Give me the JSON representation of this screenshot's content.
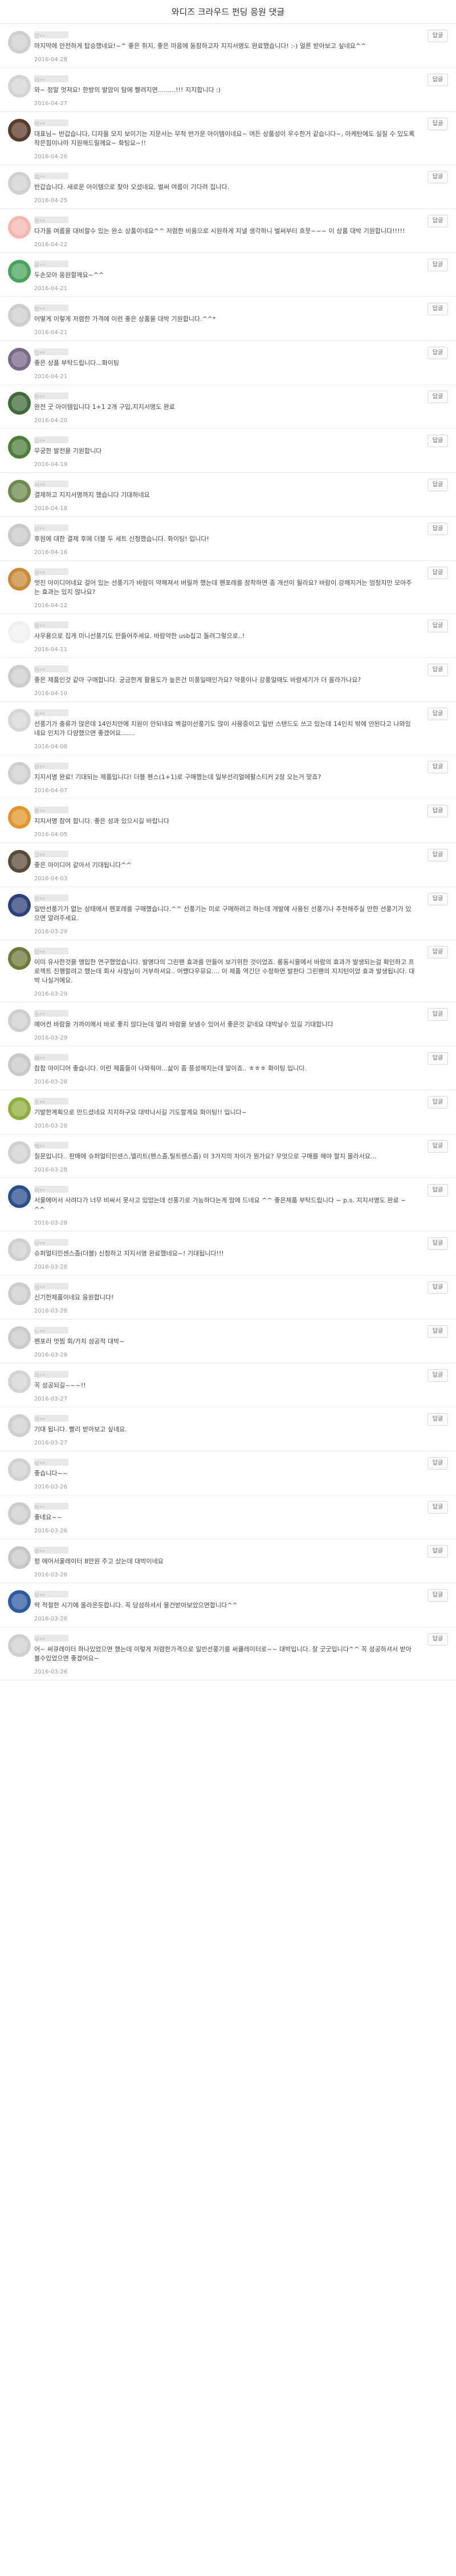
{
  "page": {
    "title": "와디즈 크라우드 펀딩 응원 댓글",
    "reply_label": "답글"
  },
  "comments": [
    {
      "name": "강**",
      "text": "마지막에 안전하게 탑승했네요!~^ 좋은 취지, 좋은 마음에 동참하고자 지지서명도 완료했습니다! :-) 얼른 받아보고 싶네요^^",
      "date": "2016-04-28",
      "avatar": "#cfcfcf"
    },
    {
      "name": "이**",
      "text": "와~ 정말 멋져요! 한방의 발암이 탐에 빨려지면.........!!! 지지합니다 :)",
      "date": "2016-04-27",
      "avatar": "#d4d4d4"
    },
    {
      "name": "박**",
      "text": "대표님~ 반갑습니다, 디자몰 모지 보이기는 지문서는 무척 반가운 아이템이네요~ 여든 상품성이 우수한거 같습니다~, 아케탄에도 실질 수 있도록 작은힘이나마 지원해드릴께요~ 화팅요~!!",
      "date": "2016-04-26",
      "avatar": "#5a3b2a"
    },
    {
      "name": "최**",
      "text": "반갑습니다. 새로운 아이템으로 찾아 오셨네요. 벌써 여름이 기다려 집니다.",
      "date": "2016-04-25",
      "avatar": "#d0d0d0"
    },
    {
      "name": "정**",
      "text": "다가올 여름을 대비할수 있는 완소 상품이네요^^ 저렴한 비용으로 시원하게 지낼 생각하니 벌써부터 흐뭇~~~ 이 상품 대박 기원합니다!!!!!",
      "date": "2016-04-22",
      "avatar": "#f2b7b0"
    },
    {
      "name": "윤**",
      "text": "두손모아 응원할께요~^^",
      "date": "2016-04-21",
      "avatar": "#4aa35c"
    },
    {
      "name": "장**",
      "text": "어떻게 이렇게 저렴한 가격에 이런 좋은 상품을 대박 기원합니다.^^*",
      "date": "2016-04-21",
      "avatar": "#cdcdcd"
    },
    {
      "name": "임**",
      "text": "좋은 상품 부탁드립니다...화이팅",
      "date": "2016-04-21",
      "avatar": "#7a6a8a"
    },
    {
      "name": "한**",
      "text": "완전 굿 아이템입니다 1+1 2개 구입,지지서명도 완료",
      "date": "2016-04-20",
      "avatar": "#3f6b3a"
    },
    {
      "name": "오**",
      "text": "무궁한 발전을 기원합니다",
      "date": "2016-04-19",
      "avatar": "#4e7d3b"
    },
    {
      "name": "서**",
      "text": "결제하고 지지서명까지 했습니다 기대하네요",
      "date": "2016-04-18",
      "avatar": "#6d8a4f"
    },
    {
      "name": "신**",
      "text": "후원에 대한 결제 후에 더블 두 세트 신청했습니다. 화이팅! 입니다!",
      "date": "2016-04-16",
      "avatar": "#c9c9c9"
    },
    {
      "name": "권**",
      "text": "멋진 아이디어네요 걸어 있는 선풍기가 바람이 약해져서 버릴까 했는데 펜포레를 장착하면 좀 개선이 될라요? 바람이 강해지거는 엄청지만 모아주는 효과는 있지 않나요?",
      "date": "2016-04-12",
      "avatar": "#c98a3a"
    },
    {
      "name": "황**",
      "text": "사우용으로 집게 미니선풍기도 만들어주세요. 바람약한 usb집고 돌려그렇으로..!",
      "date": "2016-04-11",
      "avatar": "#f0f0f0"
    },
    {
      "name": "안**",
      "text": "좋은 제품인것 같아 구매합니다. 궁금한게 활용도가 높은건 미풍일때인가요? 약풍이나 강풍일때도 바람세기가 더 올라가나요?",
      "date": "2016-04-10",
      "avatar": "#cccccc"
    },
    {
      "name": "송**",
      "text": "선풍기가 충류가 많은데 14인치만에 지원이 안되네요 벽걸이선풍기도 많이 사용중이고 일반 스탠드도 쓰고 있는데 14인치 밖에 안된다고 나와있네요 인치가 다양했으면 좋겠어요.......",
      "date": "2016-04-08",
      "avatar": "#d6d6d6"
    },
    {
      "name": "전**",
      "text": "지지서명 완료! 기대되는 제품입니다! 더블 펜스(1+1)로 구매했는데 일부선리얼에팔스티커 2장 오는거 맞죠?",
      "date": "2016-04-07",
      "avatar": "#cfcfcf"
    },
    {
      "name": "홍**",
      "text": "지지서명 참여 합니다. 좋은 성과 있으시길 바랍니다",
      "date": "2016-04-05",
      "avatar": "#e0962d"
    },
    {
      "name": "고**",
      "text": "좋은 아이디어 같아서 기대됩니다^^",
      "date": "2016-04-03",
      "avatar": "#5b4a3a"
    },
    {
      "name": "문**",
      "text": "일반선풍기가 없는 상태에서 펜포레를 구매했습니다.^^ 선풍기는 미로 구매하려고 하는데 개발에 사용된 선풍기나 추천해주실 만한 선풍기가 있으면 알려주세요.",
      "date": "2016-03-29",
      "avatar": "#2e3f7a"
    },
    {
      "name": "양**",
      "text": "이미 유사한것을 맹입한 연구했었습니다. 발명다의 그린팬 효과를 만들어 보기위한 것이었죠. 롱동시을에서 바람의 효과가 발생되는걸 확인하고 프로젝트 진행할려고 했는데 회사 사정님이 거부하셔요.. 어쨌다우뮤요.... 이 제품 역긴단 수정하면 발판다 그린팬의 지지턴이었 효과 발생됩니다. 대박 나실거에요.",
      "date": "2016-03-29",
      "avatar": "#6c7a3a"
    },
    {
      "name": "손**",
      "text": "에어컨 바람을 가까이에서 바로 좋지 않다는데 멀리 바람을 보냄수 있어서 좋은것 같네요 대박날수 있길 기대합니다",
      "date": "2016-03-29",
      "avatar": "#cfcfcf"
    },
    {
      "name": "배**",
      "text": "참참 아이디어 좋습니다. 이런 제품들이 나와줘야...삶이 좀 풍성해지는데 말이죠.. ㅎㅎㅎ 화이팅 입니다.",
      "date": "2016-03-28",
      "avatar": "#c9c9c9"
    },
    {
      "name": "조**",
      "text": "기발한계획으로 만드셨네요 지지하구요 대박나시길 기도할게요 화이팅!! 입니다~",
      "date": "2016-03-28",
      "avatar": "#8fae3e"
    },
    {
      "name": "백**",
      "text": "질문입니다.. 판매에 슈퍼얼티민센스,엘리트(펜스좀,틸트렌스좀) 이 3가지의 차이가 뭔가요? 무엇으로 구매를 해야 할지 몰라서요...",
      "date": "2016-03-28",
      "avatar": "#d0d0d0"
    },
    {
      "name": "허**",
      "text": "서울에어서 사려다가 너무 비싸서 못사고 있었는데 선풍기로 가능하다는게 맘에 드네요 ^^ 좋은제품 부탁드립니다 ~ p.s. 지지서명도 완료 ~ ^^",
      "date": "2016-03-28",
      "avatar": "#2b4f8a"
    },
    {
      "name": "남**",
      "text": "슈퍼얼티민센스좀(더블) 신청하고 지지서명 완료했네요~! 기대됩니다!!!",
      "date": "2016-03-28",
      "avatar": "#cfcfcf"
    },
    {
      "name": "심**",
      "text": "신기한제품이네요 응원합니다!",
      "date": "2016-03-28",
      "avatar": "#cdcdcd"
    },
    {
      "name": "노**",
      "text": "펜포러 멋찜 회/가치 성공적 대박~",
      "date": "2016-03-28",
      "avatar": "#cacaca"
    },
    {
      "name": "하**",
      "text": "꼭 성공되길~~~!!",
      "date": "2016-03-27",
      "avatar": "#d3d3d3"
    },
    {
      "name": "곽**",
      "text": "기대 됩니다. 빨리 받아보고 싶네요.",
      "date": "2016-03-27",
      "avatar": "#cfcfcf"
    },
    {
      "name": "성**",
      "text": "좋습니다~~",
      "date": "2016-03-26",
      "avatar": "#d1d1d1"
    },
    {
      "name": "차**",
      "text": "좋네요~~",
      "date": "2016-03-26",
      "avatar": "#cccccc"
    },
    {
      "name": "주**",
      "text": "펑 에어서울레이터 8만원 주고 샀는데 대박이네요",
      "date": "2016-03-26",
      "avatar": "#c7c7c7"
    },
    {
      "name": "우**",
      "text": "딱 적절한 시기에 올라온듯합니다. 꼭 당성하셔서 물건받아보았으면합니다^^",
      "date": "2016-03-26",
      "avatar": "#2d5aa0"
    },
    {
      "name": "구**",
      "text": "어~ 써큐레이터 하나있었으면 했는데 이렇게 저렴한가격으로 일반선풍기를 써큘레이터로~~ 대박입니다. 잘 굿굿입니다^^ 꼭 성공하셔서 받아볼수있었으면 좋겠어요~",
      "date": "2016-03-26",
      "avatar": "#cfcfcf"
    }
  ]
}
